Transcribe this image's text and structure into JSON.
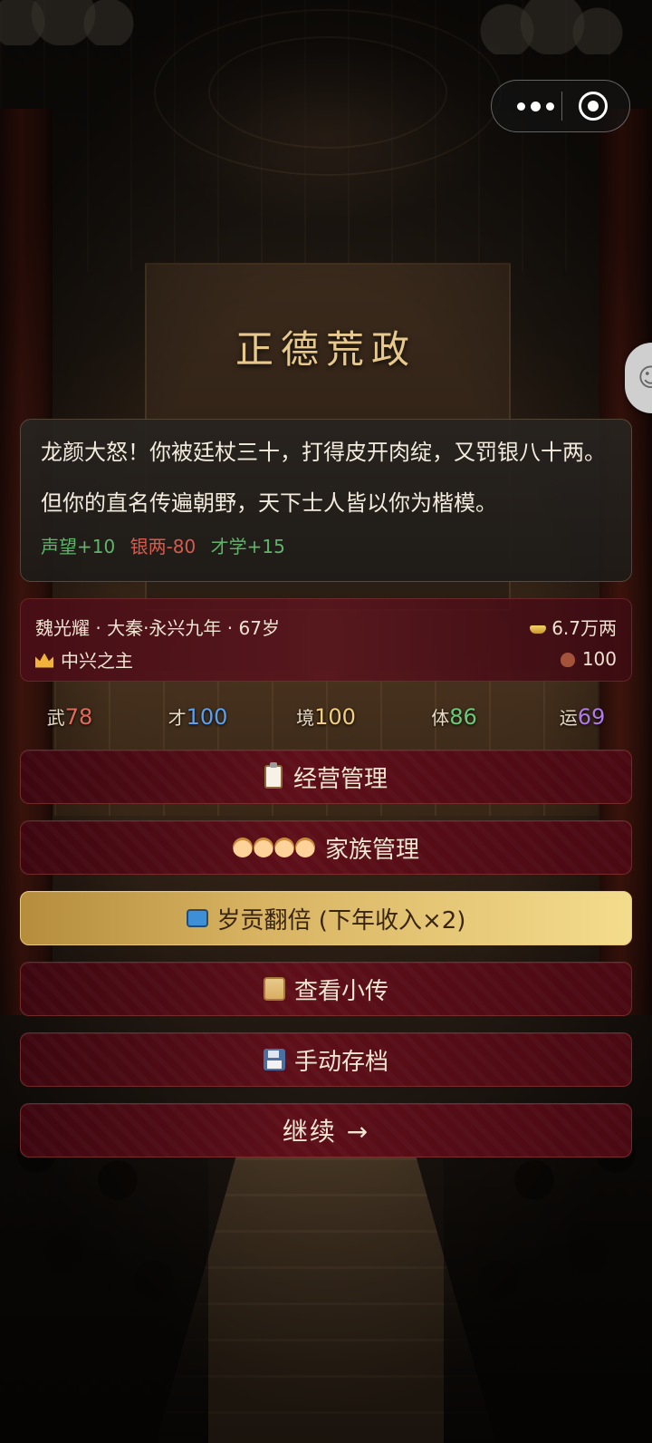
{
  "title": "正德荒政",
  "event": {
    "text": "龙颜大怒！你被廷杖三十，打得皮开肉绽，又罚银八十两。但你的直名传遍朝野，天下士人皆以你为楷模。",
    "effects": [
      {
        "text": "声望+10",
        "color": "#5fb56a"
      },
      {
        "text": "银两-80",
        "color": "#d55b4d"
      },
      {
        "text": "才学+15",
        "color": "#5fb56a"
      }
    ]
  },
  "status": {
    "name_line": "魏光耀 · 大秦·永兴九年 · 67岁",
    "title": "中兴之主",
    "silver": "6.7万两",
    "favor": "100",
    "icons": {
      "silver": "gold-ingot-icon",
      "title": "crown-icon",
      "favor": "money-bag-icon"
    }
  },
  "attributes": [
    {
      "label": "武",
      "value": "78",
      "color": "#e06a5c"
    },
    {
      "label": "才",
      "value": "100",
      "color": "#5aa0f0"
    },
    {
      "label": "境",
      "value": "100",
      "color": "#f0d080"
    },
    {
      "label": "体",
      "value": "86",
      "color": "#6cc97a"
    },
    {
      "label": "运",
      "value": "69",
      "color": "#b07ae8"
    }
  ],
  "buttons": {
    "manage": "经营管理",
    "family": "家族管理",
    "tribute": "岁贡翻倍 (下年收入×2)",
    "biography": "查看小传",
    "save": "手动存档",
    "continue": "继续 →"
  },
  "colors": {
    "title_gold": "#e8c98d",
    "button_red": "#5e0f19",
    "button_gold": "#d8b463"
  }
}
